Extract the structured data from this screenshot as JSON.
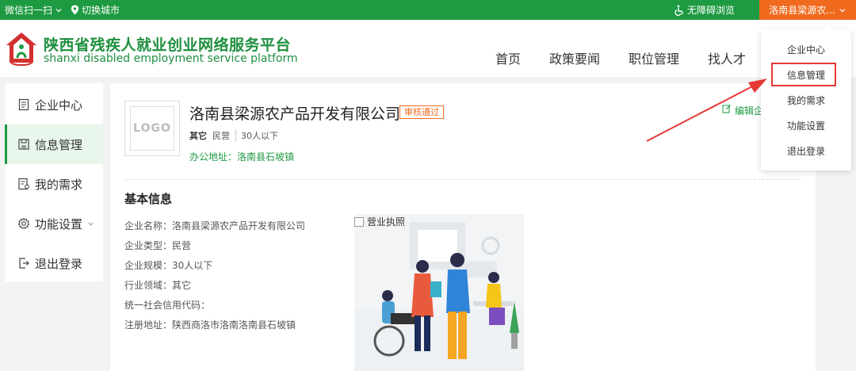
{
  "topbar": {
    "wechat_label": "微信扫一扫",
    "switch_city_label": "切换城市",
    "accessibility_label": "无障碍浏览",
    "user_label": "洛南县梁源农..."
  },
  "header": {
    "logo_cn": "陕西省残疾人就业创业网络服务平台",
    "logo_en": "shanxi disabled employment service platform",
    "nav": [
      "首页",
      "政策要闻",
      "职位管理",
      "找人才"
    ]
  },
  "sidebar": {
    "items": [
      {
        "label": "企业中心"
      },
      {
        "label": "信息管理"
      },
      {
        "label": "我的需求"
      },
      {
        "label": "功能设置"
      },
      {
        "label": "退出登录"
      }
    ]
  },
  "company": {
    "logo_text": "LOGO",
    "name": "洛南县梁源农产品开发有限公司",
    "status": "审核通过",
    "tag_industry": "其它",
    "tag_type": "民营",
    "tag_size": "30人以下",
    "office": "办公地址：洛南县石坡镇",
    "edit_label": "编辑企"
  },
  "basic_info": {
    "title": "基本信息",
    "fields": [
      "企业名称：洛南县梁源农产品开发有限公司",
      "企业类型：民营",
      "企业规模：30人以下",
      "行业领域：其它",
      "统一社会信用代码：",
      "注册地址：陕西商洛市洛南洛南县石坡镇"
    ],
    "license_label": "营业执照"
  },
  "dropdown": {
    "items": [
      "企业中心",
      "信息管理",
      "我的需求",
      "功能设置",
      "退出登录"
    ]
  },
  "colors": {
    "brand_green": "#1e9a42",
    "orange": "#f06a1e",
    "highlight_red": "#e53935"
  }
}
